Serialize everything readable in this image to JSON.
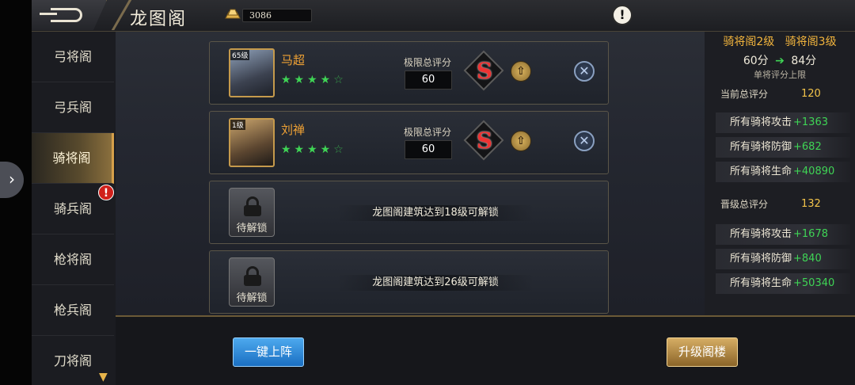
{
  "header": {
    "title": "龙图阁",
    "gold": "3086"
  },
  "sidebar": {
    "items": [
      {
        "label": "弓将阁"
      },
      {
        "label": "弓兵阁"
      },
      {
        "label": "骑将阁"
      },
      {
        "label": "骑兵阁"
      },
      {
        "label": "枪将阁"
      },
      {
        "label": "枪兵阁"
      },
      {
        "label": "刀将阁"
      }
    ],
    "active_index": 2,
    "badge": "!"
  },
  "heroes": [
    {
      "level": "65级",
      "name": "马超",
      "score_label": "极限总评分",
      "score": "60",
      "stars": 4,
      "max_stars": 5,
      "grade_icon": "S"
    },
    {
      "level": "1级",
      "name": "刘禅",
      "score_label": "极限总评分",
      "score": "60",
      "stars": 4,
      "max_stars": 5,
      "grade_icon": "S"
    }
  ],
  "locked_slots": [
    {
      "label": "待解锁",
      "message": "龙图阁建筑达到18级可解锁"
    },
    {
      "label": "待解锁",
      "message": "龙图阁建筑达到26级可解锁"
    }
  ],
  "right_panel": {
    "current_level": "骑将阁2级",
    "next_level": "骑将阁3级",
    "current_cap": "60分",
    "next_cap": "84分",
    "cap_desc": "单将评分上限",
    "current_total_label": "当前总评分",
    "current_total": "120",
    "current_stats": [
      {
        "label": "所有骑将攻击",
        "value": "+1363"
      },
      {
        "label": "所有骑将防御",
        "value": "+682"
      },
      {
        "label": "所有骑将生命",
        "value": "+40890"
      }
    ],
    "next_total_label": "晋级总评分",
    "next_total": "132",
    "next_stats": [
      {
        "label": "所有骑将攻击",
        "value": "+1678"
      },
      {
        "label": "所有骑将防御",
        "value": "+840"
      },
      {
        "label": "所有骑将生命",
        "value": "+50340"
      }
    ]
  },
  "buttons": {
    "auto_deploy": "一键上阵",
    "upgrade": "升级阁楼"
  },
  "colors": {
    "accent_gold": "#f3b53d",
    "bonus_green": "#3fd455",
    "hero_name": "#f0a234"
  }
}
